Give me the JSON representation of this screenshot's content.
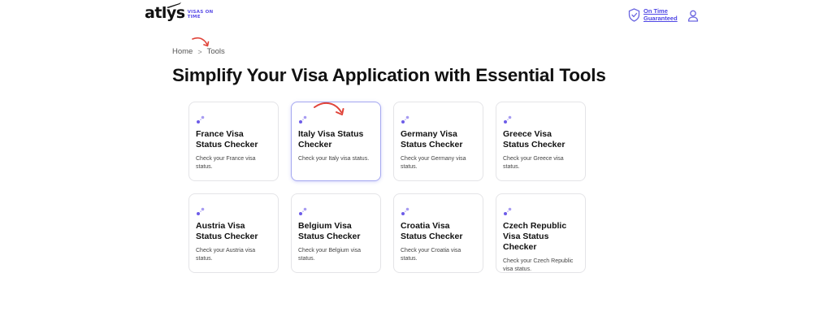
{
  "header": {
    "logo_text": "atlys",
    "logo_tagline": "VISAS ON TIME",
    "guarantee_label": "On Time Guaranteed",
    "icons": {
      "shield": "shield-check-icon",
      "user": "user-icon",
      "plane": "plane-icon"
    }
  },
  "breadcrumb": {
    "items": [
      "Home",
      "Tools"
    ],
    "separator": ">"
  },
  "page": {
    "title": "Simplify Your Visa Application with Essential Tools"
  },
  "cards": [
    {
      "title": "France Visa Status Checker",
      "description": "Check your France visa status.",
      "active": false
    },
    {
      "title": "Italy Visa Status Checker",
      "description": "Check your Italy visa status.",
      "active": true
    },
    {
      "title": "Germany Visa Status Checker",
      "description": "Check your Germany visa status.",
      "active": false
    },
    {
      "title": "Greece Visa Status Checker",
      "description": "Check your Greece visa status.",
      "active": false
    },
    {
      "title": "Austria Visa Status Checker",
      "description": "Check your Austria visa status.",
      "active": false
    },
    {
      "title": "Belgium Visa Status Checker",
      "description": "Check your Belgium visa status.",
      "active": false
    },
    {
      "title": "Croatia Visa Status Checker",
      "description": "Check your Croatia visa status.",
      "active": false
    },
    {
      "title": "Czech Republic Visa Status Checker",
      "description": "Check your Czech Republic visa status.",
      "active": false
    }
  ],
  "colors": {
    "accent": "#4f46e5",
    "card_icon": "#6d5ce8",
    "annotation_arrow": "#e0443a",
    "card_border": "#e4e4e7"
  }
}
